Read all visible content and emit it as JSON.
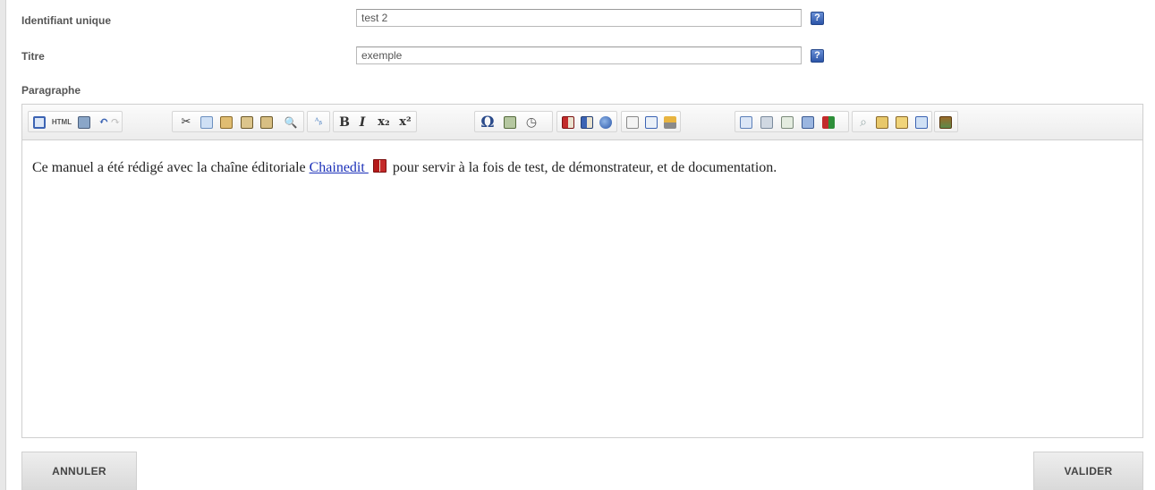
{
  "form": {
    "identifier": {
      "label": "Identifiant unique",
      "value": "test 2"
    },
    "title": {
      "label": "Titre",
      "value": "exemple"
    },
    "paragraph": {
      "label": "Paragraphe"
    }
  },
  "help_icon_glyph": "?",
  "toolbar": {
    "html_label": "HTML",
    "bold": "B",
    "italic": "I",
    "omega": "Ω",
    "subscript": "x₂",
    "superscript": "x²"
  },
  "content": {
    "before_link": "Ce manuel a été rédigé avec la chaîne éditoriale ",
    "link": "Chainedit ",
    "after_link": " pour servir à la fois de test, de démonstrateur, et de documentation."
  },
  "buttons": {
    "cancel": "ANNULER",
    "validate": "VALIDER"
  },
  "colors": {
    "help_icon": "#3a62b8",
    "link": "#1a2fb8",
    "button_bg": "#e3e3e3"
  }
}
